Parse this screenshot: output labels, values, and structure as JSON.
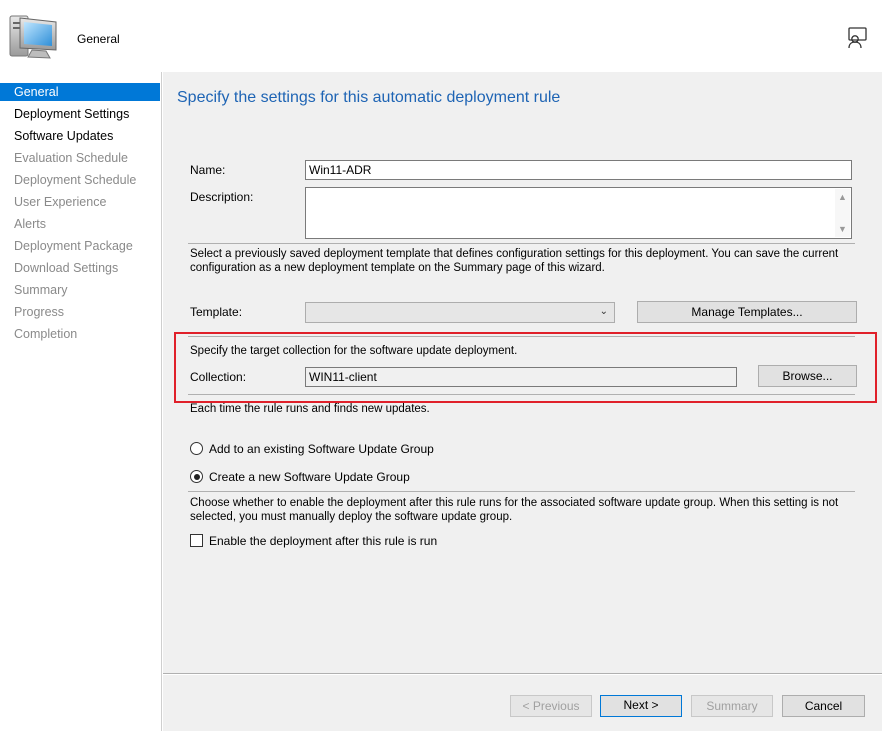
{
  "header": {
    "title": "General"
  },
  "sidebar": {
    "items": [
      {
        "label": "General",
        "state": "active"
      },
      {
        "label": "Deployment Settings",
        "state": "done"
      },
      {
        "label": "Software Updates",
        "state": "done"
      },
      {
        "label": "Evaluation Schedule",
        "state": "pending"
      },
      {
        "label": "Deployment Schedule",
        "state": "pending"
      },
      {
        "label": "User Experience",
        "state": "pending"
      },
      {
        "label": "Alerts",
        "state": "pending"
      },
      {
        "label": "Deployment Package",
        "state": "pending"
      },
      {
        "label": "Download Settings",
        "state": "pending"
      },
      {
        "label": "Summary",
        "state": "pending"
      },
      {
        "label": "Progress",
        "state": "pending"
      },
      {
        "label": "Completion",
        "state": "pending"
      }
    ]
  },
  "main": {
    "title": "Specify the settings for this automatic deployment rule",
    "name_label": "Name:",
    "name_value": "Win11-ADR",
    "description_label": "Description:",
    "description_value": "",
    "template_text": "Select a previously saved deployment template that defines configuration settings for this deployment. You can save the current configuration as a new deployment template on the Summary page of this wizard.",
    "template_label": "Template:",
    "template_value": "",
    "manage_templates_label": "Manage Templates...",
    "collection_text": "Specify the target collection for the software update deployment.",
    "collection_label": "Collection:",
    "collection_value": "WIN11-client",
    "browse_label": "Browse...",
    "rule_runs_text": "Each time the rule runs and finds new updates.",
    "radio_existing_label": "Add to an existing Software Update Group",
    "radio_new_label": "Create a new Software Update Group",
    "radio_selected": "new",
    "enable_text": "Choose whether to enable the deployment after this rule runs for the associated software update group. When this setting is not selected, you must manually deploy the software update group.",
    "enable_label": "Enable the deployment after this rule is run",
    "enable_checked": false
  },
  "footer": {
    "previous_label": "< Previous",
    "next_label": "Next >",
    "summary_label": "Summary",
    "cancel_label": "Cancel"
  },
  "colors": {
    "accent": "#0078d7",
    "title_blue": "#1e64b4",
    "highlight_red": "#e0202a"
  }
}
